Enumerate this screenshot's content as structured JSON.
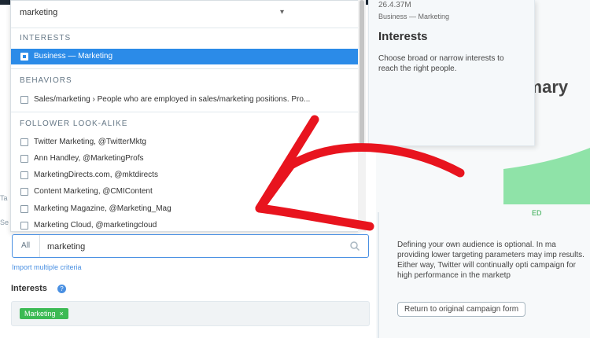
{
  "dropdown": {
    "search_value": "marketing",
    "caret": "▾",
    "sections": {
      "interests": "INTERESTS",
      "behaviors": "BEHAVIORS",
      "follower": "FOLLOWER LOOK-ALIKE"
    },
    "interests_items": [
      "Business — Marketing"
    ],
    "behaviors_items": [
      "Sales/marketing › People who are employed in sales/marketing positions. Pro..."
    ],
    "follower_items": [
      "Twitter Marketing, @TwitterMktg",
      "Ann Handley, @MarketingProfs",
      "MarketingDirects.com, @mktdirects",
      "Content Marketing, @CMIContent",
      "Marketing Magazine, @Marketing_Mag",
      "Marketing Cloud, @marketingcloud"
    ]
  },
  "tooltip": {
    "size": "26.4.37M",
    "path": "Business — Marketing",
    "title": "Interests",
    "description": "Choose broad or narrow interests to reach the right people."
  },
  "targeting": {
    "prefix": "All",
    "value": "marketing",
    "import_link": "Import multiple criteria",
    "interests_label": "Interests",
    "help": "?",
    "tag": "Marketing",
    "tag_remove": "×"
  },
  "summary": {
    "title": "mmary",
    "chart_caption": "ED",
    "text": "Defining your own audience is optional. In ma providing lower targeting parameters may imp results. Either way, Twitter will continually opti campaign for high performance in the marketp",
    "return_button": "Return to original campaign form"
  },
  "edge": [
    "Ta",
    "Se"
  ],
  "colors": {
    "selected": "#2b8be8",
    "tag": "#3cba54",
    "arrow": "#e8141e",
    "link": "#4a90e2"
  }
}
